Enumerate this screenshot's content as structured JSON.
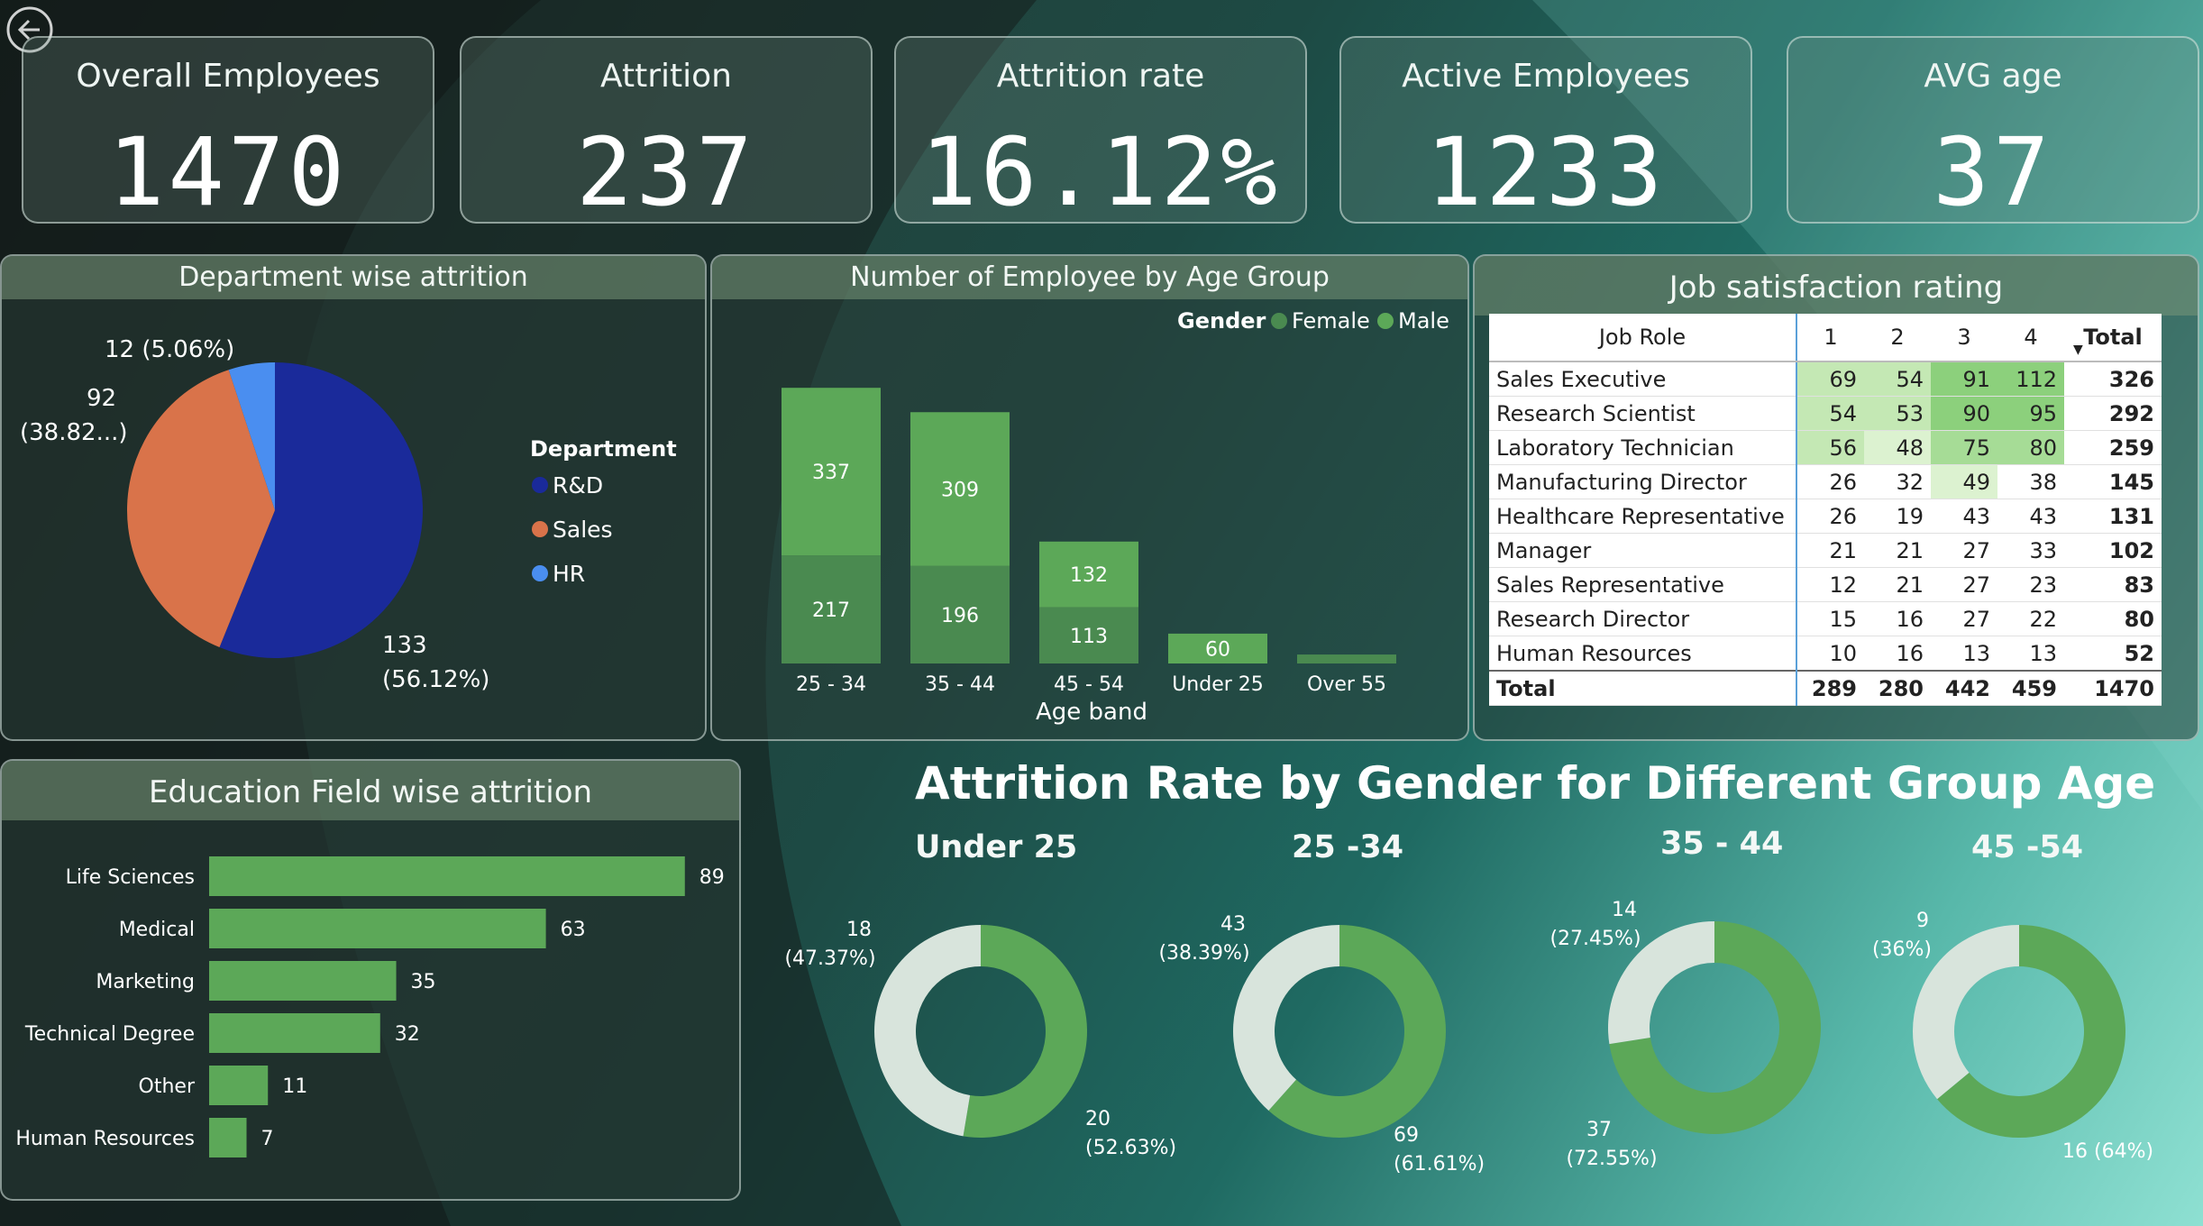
{
  "kpis": [
    {
      "title": "Overall Employees",
      "value": "1470"
    },
    {
      "title": "Attrition",
      "value": "237"
    },
    {
      "title": "Attrition rate",
      "value": "16.12%"
    },
    {
      "title": "Active Employees",
      "value": "1233"
    },
    {
      "title": "AVG age",
      "value": "37"
    }
  ],
  "colors": {
    "rd": "#1a2a9a",
    "sales": "#d9734a",
    "hr": "#4a8ef0",
    "male": "#5ca858",
    "female": "#4a8a50",
    "donut_light": "#d8e4dc",
    "donut_green": "#5ca858",
    "bar": "#5ca858"
  },
  "chart_data": [
    {
      "type": "pie",
      "title": "Department wise attrition",
      "legend_title": "Department",
      "legend": [
        "R&D",
        "Sales",
        "HR"
      ],
      "values": [
        133,
        92,
        12
      ],
      "labels": [
        "133",
        "(56.12%)",
        "92",
        "(38.82...)",
        "12 (5.06%)"
      ]
    },
    {
      "type": "bar",
      "title": "Number of Employee by Age Group",
      "xlabel": "Age band",
      "legend_title": "Gender",
      "legend": [
        "Female",
        "Male"
      ],
      "categories": [
        "25 - 34",
        "35 - 44",
        "45 - 54",
        "Under 25",
        "Over 55"
      ],
      "series": [
        {
          "name": "Female",
          "values": [
            217,
            196,
            113,
            0,
            18
          ]
        },
        {
          "name": "Male",
          "values": [
            337,
            309,
            132,
            60,
            0
          ]
        }
      ],
      "value_labels": {
        "Female": [
          "217",
          "196",
          "113",
          "",
          ""
        ],
        "Male": [
          "337",
          "309",
          "132",
          "60",
          ""
        ]
      }
    },
    {
      "type": "table",
      "title": "Job satisfaction rating",
      "columns": [
        "Job Role",
        "1",
        "2",
        "3",
        "4",
        "Total"
      ],
      "rows": [
        [
          "Sales Executive",
          "69",
          "54",
          "91",
          "112",
          "326"
        ],
        [
          "Research Scientist",
          "54",
          "53",
          "90",
          "95",
          "292"
        ],
        [
          "Laboratory Technician",
          "56",
          "48",
          "75",
          "80",
          "259"
        ],
        [
          "Manufacturing Director",
          "26",
          "32",
          "49",
          "38",
          "145"
        ],
        [
          "Healthcare Representative",
          "26",
          "19",
          "43",
          "43",
          "131"
        ],
        [
          "Manager",
          "21",
          "21",
          "27",
          "33",
          "102"
        ],
        [
          "Sales Representative",
          "12",
          "21",
          "27",
          "23",
          "83"
        ],
        [
          "Research Director",
          "15",
          "16",
          "27",
          "22",
          "80"
        ],
        [
          "Human Resources",
          "10",
          "16",
          "13",
          "13",
          "52"
        ]
      ],
      "total_row": [
        "Total",
        "289",
        "280",
        "442",
        "459",
        "1470"
      ]
    },
    {
      "type": "bar",
      "title": "Education Field wise attrition",
      "categories": [
        "Life Sciences",
        "Medical",
        "Marketing",
        "Technical Degree",
        "Other",
        "Human Resources"
      ],
      "values": [
        89,
        63,
        35,
        32,
        11,
        7
      ]
    },
    {
      "type": "pie",
      "title": "Attrition Rate by Gender for Different Group Age",
      "groups": [
        {
          "title": "Under 25",
          "values": [
            18,
            20
          ],
          "labels": [
            "18",
            "(47.37%)",
            "20",
            "(52.63%)"
          ]
        },
        {
          "title": "25 -34",
          "values": [
            43,
            69
          ],
          "labels": [
            "43",
            "(38.39%)",
            "69",
            "(61.61%)"
          ]
        },
        {
          "title": "35 - 44",
          "values": [
            14,
            37
          ],
          "labels": [
            "14",
            "(27.45%)",
            "37",
            "(72.55%)"
          ]
        },
        {
          "title": "45 -54",
          "values": [
            9,
            16
          ],
          "labels": [
            "9",
            "(36%)",
            "16 (64%)"
          ]
        }
      ]
    }
  ]
}
